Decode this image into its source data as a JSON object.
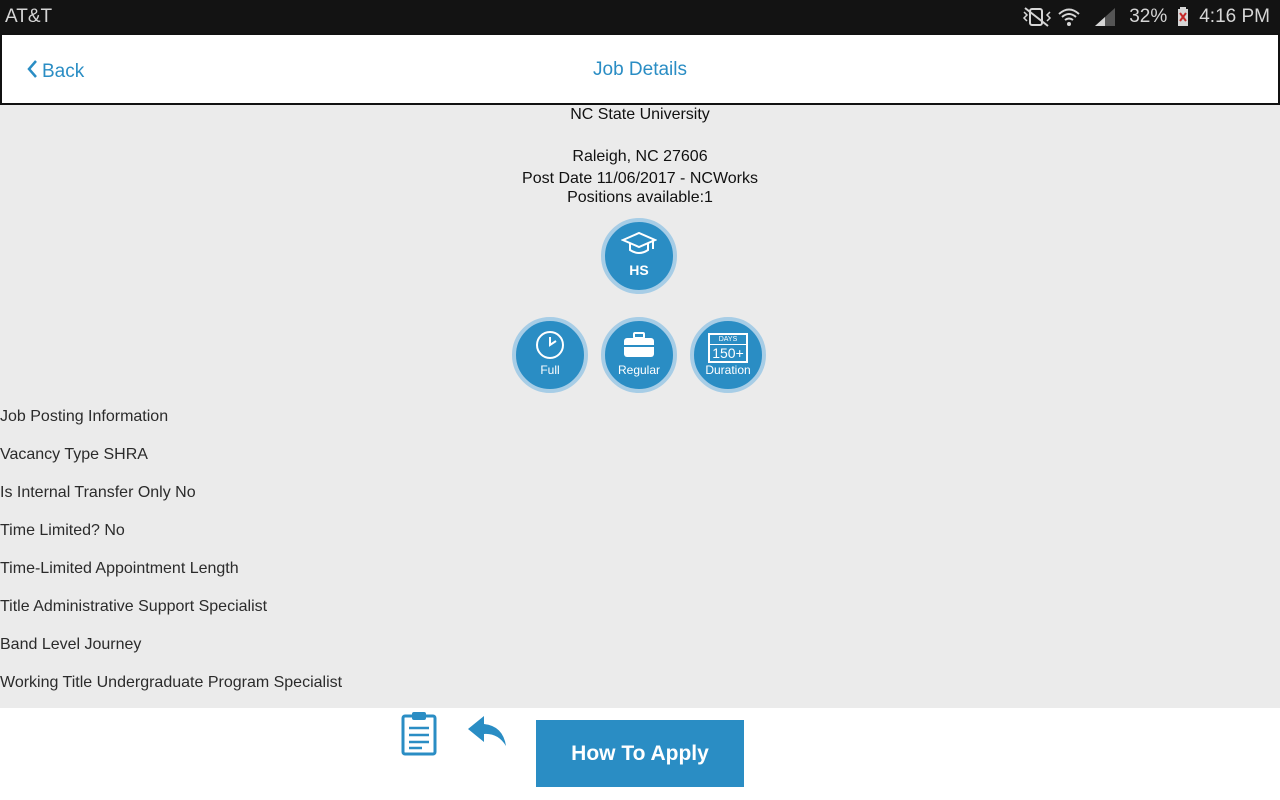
{
  "status_bar": {
    "carrier": "AT&T",
    "battery": "32%",
    "time": "4:16 PM"
  },
  "header": {
    "back_label": "Back",
    "title": "Job Details"
  },
  "job": {
    "employer": "NC State University",
    "location": "Raleigh, NC 27606",
    "post_date": "Post Date 11/06/2017 - NCWorks",
    "positions": "Positions available:1"
  },
  "badges": {
    "education": "HS",
    "schedule": "Full",
    "type": "Regular",
    "duration_top": "DAYS",
    "duration_value": "150+",
    "duration": "Duration"
  },
  "info_lines": [
    "Job Posting Information",
    "Vacancy Type SHRA",
    "Is Internal Transfer Only No",
    "Time Limited? No",
    "Time-Limited Appointment Length",
    "Title Administrative Support Specialist",
    "Band Level Journey",
    "Working Title Undergraduate Program Specialist"
  ],
  "footer": {
    "apply_label": "How To Apply"
  },
  "colors": {
    "accent": "#2a8dc4",
    "content_bg": "#ebebeb",
    "status_bg": "#131313"
  }
}
